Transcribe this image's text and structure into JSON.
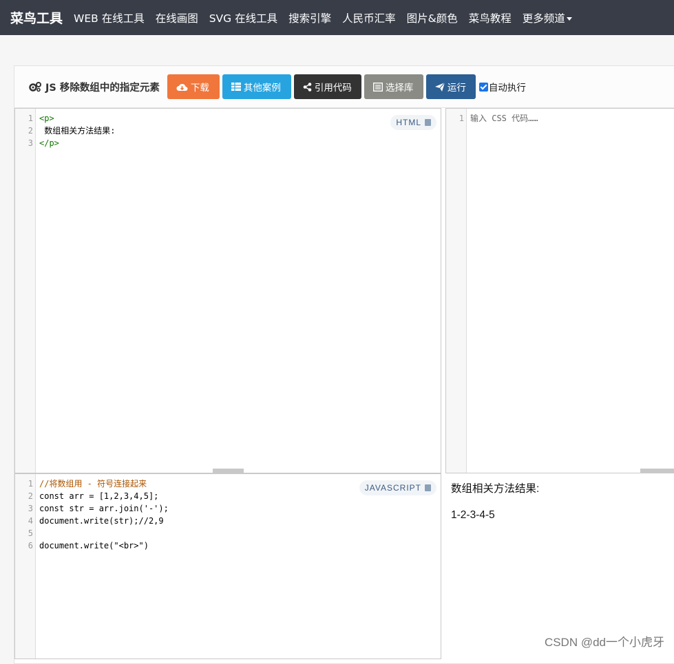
{
  "nav": {
    "brand": "菜鸟工具",
    "links": [
      "WEB 在线工具",
      "在线画图",
      "SVG 在线工具",
      "搜索引擎",
      "人民币汇率",
      "图片&颜色",
      "菜鸟教程",
      "更多频道"
    ]
  },
  "toolbar": {
    "title": "JS 移除数组中的指定元素",
    "download": "下载",
    "examples": "其他案例",
    "share": "引用代码",
    "library": "选择库",
    "run": "运行",
    "autorun": "自动执行"
  },
  "html_editor": {
    "badge": "HTML",
    "lines": [
      {
        "n": "1",
        "text": "<p>"
      },
      {
        "n": "2",
        "text": " 数组相关方法结果:"
      },
      {
        "n": "3",
        "text": "</p>"
      }
    ]
  },
  "css_editor": {
    "lines": [
      {
        "n": "1",
        "text": "输入 CSS 代码……"
      }
    ]
  },
  "js_editor": {
    "badge": "JAVASCRIPT",
    "lines": [
      {
        "n": "1",
        "text": "//将数组用 - 符号连接起来"
      },
      {
        "n": "2",
        "text": "const arr = [1,2,3,4,5];"
      },
      {
        "n": "3",
        "text": "const str = arr.join('-');"
      },
      {
        "n": "4",
        "text": "document.write(str);//2,9"
      },
      {
        "n": "5",
        "text": ""
      },
      {
        "n": "6",
        "text": "document.write(\"<br>\")"
      }
    ]
  },
  "result": {
    "heading": "数组相关方法结果:",
    "output": "1-2-3-4-5"
  },
  "watermark": "CSDN @dd一个小虎牙",
  "colors": {
    "navbar": "#383d48",
    "download": "#f0763c",
    "examples": "#27a4e0",
    "share": "#333333",
    "library": "#8b8b86",
    "run": "#2c5f94"
  }
}
